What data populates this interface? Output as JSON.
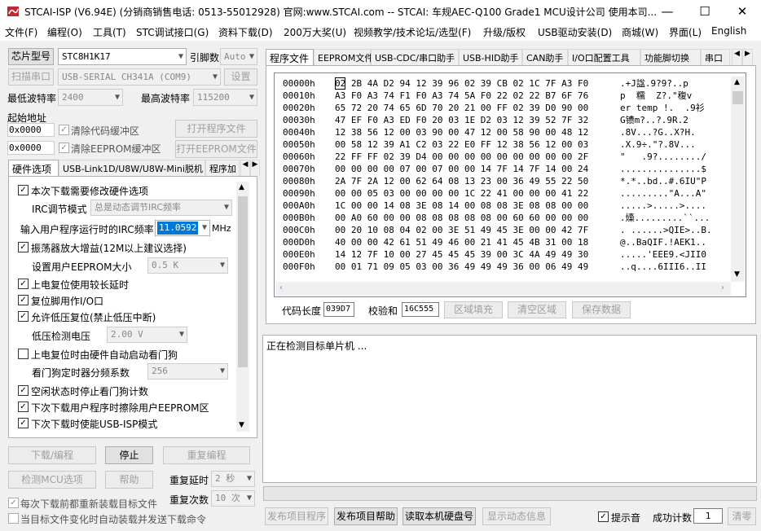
{
  "window": {
    "title": "STCAI-ISP (V6.94E) (分销商销售电话: 0513-55012928) 官网:www.STCAI.com  -- STCAI: 车规AEC-Q100 Grade1 MCU设计公司 使用本司...",
    "minimize": "—",
    "maximize": "☐",
    "close": "✕"
  },
  "menu": [
    "文件(F)",
    "编程(O)",
    "工具(T)",
    "STC调试接口(G)",
    "资料下载(D)",
    "200万大奖(U)",
    "视频教学/技术论坛/选型(F)",
    "升级/版权",
    "USB驱动安装(D)",
    "商城(W)",
    "界面(L)",
    "English"
  ],
  "left": {
    "chip_btn": "芯片型号",
    "chip_value": "STC8H1K17",
    "pins_label": "引脚数",
    "pins_value": "Auto",
    "scan_btn": "扫描串口",
    "port_value": "USB-SERIAL CH341A (COM9)",
    "settings_btn": "设置",
    "min_baud_label": "最低波特率",
    "min_baud_value": "2400",
    "max_baud_label": "最高波特率",
    "max_baud_value": "115200",
    "start_addr_label": "起始地址",
    "code_addr": "0x0000",
    "clear_code_label": "清除代码缓冲区",
    "open_prog_btn": "打开程序文件",
    "eeprom_addr": "0x0000",
    "clear_eeprom_label": "清除EEPROM缓冲区",
    "open_eeprom_btn": "打开EEPROM文件",
    "tabs": [
      "硬件选项",
      "USB-Link1D/U8W/U8W-Mini脱机",
      "程序加"
    ],
    "opt_modify": "本次下载需要修改硬件选项",
    "irc_mode_label": "IRC调节模式",
    "irc_mode_value": "总是动态调节IRC频率",
    "irc_freq_label": "输入用户程序运行时的IRC频率",
    "irc_freq_value": "11.0592",
    "irc_unit": "MHz",
    "osc_gain": "振荡器放大增益(12M以上建议选择)",
    "eeprom_size_label": "设置用户EEPROM大小",
    "eeprom_size_value": "0.5 K",
    "long_reset": "上电复位使用较长延时",
    "reset_io": "复位脚用作I/O口",
    "lvr": "允许低压复位(禁止低压中断)",
    "lvd_label": "低压检测电压",
    "lvd_value": "2.00 V",
    "wdt_auto": "上电复位时由硬件自动启动看门狗",
    "wdt_div_label": "看门狗定时器分频系数",
    "wdt_div_value": "256",
    "wdt_idle": "空闲状态时停止看门狗计数",
    "erase_eeprom": "下次下载用户程序时擦除用户EEPROM区",
    "usb_isp": "下次下载时使能USB-ISP模式",
    "download_btn": "下载/编程",
    "stop_btn": "停止",
    "reprog_btn": "重复编程",
    "check_mcu_btn": "检测MCU选项",
    "help_btn": "帮助",
    "repeat_delay_label": "重复延时",
    "repeat_delay_value": "2 秒",
    "repeat_count_label": "重复次数",
    "repeat_count_value": "10 次",
    "reload_label": "每次下载前都重新装载目标文件",
    "auto_send_label": "当目标文件变化时自动装载并发送下载命令"
  },
  "right": {
    "tabs": [
      "程序文件",
      "EEPROM文件",
      "USB-CDC/串口助手",
      "USB-HID助手",
      "CAN助手",
      "I/O口配置工具",
      "功能脚切换",
      "串口"
    ],
    "hex_rows": [
      {
        "addr": "00000h",
        "bytes": "02 2B 4A D2 94 12 39 96 02 39 CB 02 1C 7F A3 F0",
        "ascii": ".+J諡.9?9?..p"
      },
      {
        "addr": "00010h",
        "bytes": "A3 F0 A3 74 F1 F0 A3 74 5A F0 22 02 22 B7 6F 76",
        "ascii": "p  糯  Z?.\"稪v"
      },
      {
        "addr": "00020h",
        "bytes": "65 72 20 74 65 6D 70 20 21 00 FF 02 39 D0 90 00",
        "ascii": "er temp !.  .9衫"
      },
      {
        "addr": "00030h",
        "bytes": "47 EF F0 A3 ED F0 20 03 1E D2 03 12 39 52 7F 32",
        "ascii": "G镄m?..?.9R.2"
      },
      {
        "addr": "00040h",
        "bytes": "12 38 56 12 00 03 90 00 47 12 00 58 90 00 48 12",
        "ascii": ".8V...?G..X?H."
      },
      {
        "addr": "00050h",
        "bytes": "00 58 12 39 A1 C2 03 22 E0 FF 12 38 56 12 00 03",
        "ascii": ".X.9÷.\"?.8V..."
      },
      {
        "addr": "00060h",
        "bytes": "22 FF FF 02 39 D4 00 00 00 00 00 00 00 00 00 2F",
        "ascii": "\"   .9?......../"
      },
      {
        "addr": "00070h",
        "bytes": "00 00 00 00 07 00 07 00 00 14 7F 14 7F 14 00 24",
        "ascii": "...............$"
      },
      {
        "addr": "00080h",
        "bytes": "2A 7F 2A 12 00 62 64 08 13 23 00 36 49 55 22 50",
        "ascii": "*.*..bd..#.6IU\"P"
      },
      {
        "addr": "00090h",
        "bytes": "00 00 05 03 00 00 00 00 1C 22 41 00 00 00 41 22",
        "ascii": ".........\"A...A\""
      },
      {
        "addr": "000A0h",
        "bytes": "1C 00 00 14 08 3E 08 14 00 08 08 3E 08 08 00 00",
        "ascii": ".....>.....>...."
      },
      {
        "addr": "000B0h",
        "bytes": "00 A0 60 00 00 08 08 08 08 08 00 60 60 00 00 00",
        "ascii": ".燺.........``..."
      },
      {
        "addr": "000C0h",
        "bytes": "00 20 10 08 04 02 00 3E 51 49 45 3E 00 00 42 7F",
        "ascii": ". ......>QIE>..B."
      },
      {
        "addr": "000D0h",
        "bytes": "40 00 00 42 61 51 49 46 00 21 41 45 4B 31 00 18",
        "ascii": "@..BaQIF.!AEK1.."
      },
      {
        "addr": "000E0h",
        "bytes": "14 12 7F 10 00 27 45 45 45 39 00 3C 4A 49 49 30",
        "ascii": ".....'EEE9.<JII0"
      },
      {
        "addr": "000F0h",
        "bytes": "00 01 71 09 05 03 00 36 49 49 49 36 00 06 49 49",
        "ascii": "..q....6III6..II"
      }
    ],
    "code_len_label": "代码长度",
    "code_len_value": "039D7",
    "checksum_label": "校验和",
    "checksum_value": "16C555",
    "fill_btn": "区域填充",
    "clear_btn": "清空区域",
    "save_btn": "保存数据",
    "log_text": "正在检测目标单片机 ...",
    "publish_prog_btn": "发布项目程序",
    "publish_help_btn": "发布项目帮助",
    "read_disk_btn": "读取本机硬盘号",
    "show_dynamic_btn": "显示动态信息",
    "beep_label": "提示音",
    "success_label": "成功计数",
    "success_value": "1",
    "clear_count_btn": "清零"
  }
}
